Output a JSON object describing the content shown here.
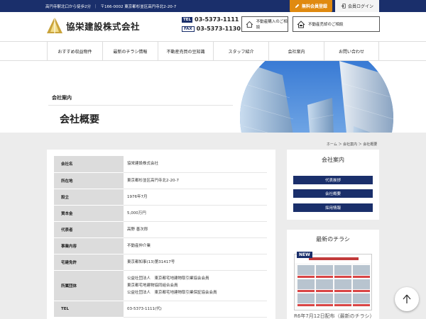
{
  "topbar": {
    "access": "高円寺駅北口から徒歩2分",
    "address": "〒166-0002 東京都杉並区高円寺北2-20-7",
    "register_label": "無料会員登録",
    "login_label": "会員ログイン"
  },
  "header": {
    "company_name": "協栄建設株式会社",
    "tel_badge": "TEL",
    "tel": "03-5373-1111",
    "fax_badge": "FAX",
    "fax": "03-5373-1130",
    "buy_consult": "不動産購入のご相談",
    "sell_consult": "不動産売却のご相談"
  },
  "nav": {
    "items": [
      "おすすめ収益物件",
      "最新のチラシ情報",
      "不動産売買の豆知識",
      "スタッフ紹介",
      "会社案内",
      "お問い合わせ"
    ]
  },
  "hero": {
    "subtitle": "会社案内",
    "title": "会社概要"
  },
  "breadcrumb": "ホーム ＞ 会社案内 ＞ 会社概要",
  "company_table": [
    {
      "label": "会社名",
      "value": "協栄建設株式会社"
    },
    {
      "label": "所在地",
      "value": "東京都杉並区高円寺北2-20-7"
    },
    {
      "label": "設立",
      "value": "1976年7月"
    },
    {
      "label": "資本金",
      "value": "5,000万円"
    },
    {
      "label": "代表者",
      "value": "高野 善次郎"
    },
    {
      "label": "事業内容",
      "value": "不動産仲介業"
    },
    {
      "label": "宅建免許",
      "value": "東京都知事(13)第31417号"
    },
    {
      "label": "所属団体",
      "lines": [
        "公益社団法人　東京都宅地建物取引業協会会員",
        "東京都宅地建物協同組合会員",
        "公益社団法人　東京都宅地建物取引業保証協会会員"
      ]
    },
    {
      "label": "TEL",
      "value": "03-5373-1111(代)"
    }
  ],
  "sidebar": {
    "about_title": "会社案内",
    "about_items": [
      "代表挨拶",
      "会社概要",
      "採用情報"
    ],
    "flyer_title": "最新のチラシ",
    "new_badge": "NEW",
    "flyer_caption": "R6年7月12日配布（最新のチラシ）"
  },
  "colors": {
    "navy": "#1a2f6b",
    "orange": "#e08a10"
  }
}
